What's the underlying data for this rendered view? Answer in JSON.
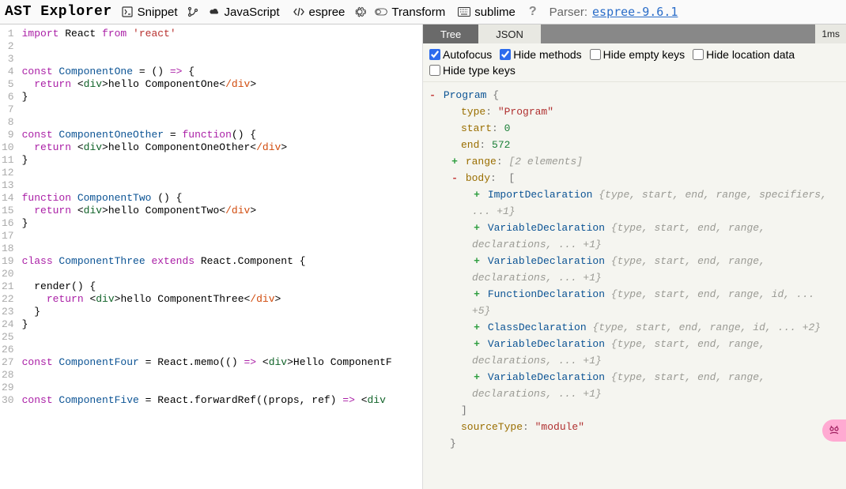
{
  "toolbar": {
    "brand": "AST Explorer",
    "snippet": "Snippet",
    "language": "JavaScript",
    "parser": "espree",
    "transform": "Transform",
    "keymap": "sublime",
    "parser_label": "Parser:",
    "parser_link": "espree-9.6.1"
  },
  "editor_lines": [
    {
      "n": 1,
      "tokens": [
        {
          "t": "import ",
          "c": "k"
        },
        {
          "t": "React ",
          "c": "plain"
        },
        {
          "t": "from ",
          "c": "k"
        },
        {
          "t": "'react'",
          "c": "str"
        }
      ]
    },
    {
      "n": 2,
      "tokens": []
    },
    {
      "n": 3,
      "tokens": []
    },
    {
      "n": 4,
      "tokens": [
        {
          "t": "const ",
          "c": "k"
        },
        {
          "t": "ComponentOne ",
          "c": "cls"
        },
        {
          "t": "= () ",
          "c": "plain"
        },
        {
          "t": "=>",
          "c": "k"
        },
        {
          "t": " {",
          "c": "plain"
        }
      ]
    },
    {
      "n": 5,
      "tokens": [
        {
          "t": "  ",
          "c": "plain"
        },
        {
          "t": "return ",
          "c": "k"
        },
        {
          "t": "<",
          "c": "plain"
        },
        {
          "t": "div",
          "c": "tag"
        },
        {
          "t": ">",
          "c": "plain"
        },
        {
          "t": "hello ComponentOne",
          "c": "plain"
        },
        {
          "t": "<",
          "c": "plain"
        },
        {
          "t": "/div",
          "c": "tagc"
        },
        {
          "t": ">",
          "c": "plain"
        }
      ]
    },
    {
      "n": 6,
      "tokens": [
        {
          "t": "}",
          "c": "plain"
        }
      ]
    },
    {
      "n": 7,
      "tokens": []
    },
    {
      "n": 8,
      "tokens": []
    },
    {
      "n": 9,
      "tokens": [
        {
          "t": "const ",
          "c": "k"
        },
        {
          "t": "ComponentOneOther ",
          "c": "cls"
        },
        {
          "t": "= ",
          "c": "plain"
        },
        {
          "t": "function",
          "c": "k"
        },
        {
          "t": "() {",
          "c": "plain"
        }
      ]
    },
    {
      "n": 10,
      "tokens": [
        {
          "t": "  ",
          "c": "plain"
        },
        {
          "t": "return ",
          "c": "k"
        },
        {
          "t": "<",
          "c": "plain"
        },
        {
          "t": "div",
          "c": "tag"
        },
        {
          "t": ">",
          "c": "plain"
        },
        {
          "t": "hello ComponentOneOther",
          "c": "plain"
        },
        {
          "t": "<",
          "c": "plain"
        },
        {
          "t": "/div",
          "c": "tagc"
        },
        {
          "t": ">",
          "c": "plain"
        }
      ]
    },
    {
      "n": 11,
      "tokens": [
        {
          "t": "}",
          "c": "plain"
        }
      ]
    },
    {
      "n": 12,
      "tokens": []
    },
    {
      "n": 13,
      "tokens": []
    },
    {
      "n": 14,
      "tokens": [
        {
          "t": "function ",
          "c": "k"
        },
        {
          "t": "ComponentTwo ",
          "c": "cls"
        },
        {
          "t": "() {",
          "c": "plain"
        }
      ]
    },
    {
      "n": 15,
      "tokens": [
        {
          "t": "  ",
          "c": "plain"
        },
        {
          "t": "return ",
          "c": "k"
        },
        {
          "t": "<",
          "c": "plain"
        },
        {
          "t": "div",
          "c": "tag"
        },
        {
          "t": ">",
          "c": "plain"
        },
        {
          "t": "hello ComponentTwo",
          "c": "plain"
        },
        {
          "t": "<",
          "c": "plain"
        },
        {
          "t": "/div",
          "c": "tagc"
        },
        {
          "t": ">",
          "c": "plain"
        }
      ]
    },
    {
      "n": 16,
      "tokens": [
        {
          "t": "}",
          "c": "plain"
        }
      ]
    },
    {
      "n": 17,
      "tokens": []
    },
    {
      "n": 18,
      "tokens": []
    },
    {
      "n": 19,
      "tokens": [
        {
          "t": "class ",
          "c": "k"
        },
        {
          "t": "ComponentThree ",
          "c": "cls"
        },
        {
          "t": "extends ",
          "c": "k"
        },
        {
          "t": "React.Component {",
          "c": "plain"
        }
      ]
    },
    {
      "n": 20,
      "tokens": []
    },
    {
      "n": 21,
      "tokens": [
        {
          "t": "  render() {",
          "c": "plain"
        }
      ]
    },
    {
      "n": 22,
      "tokens": [
        {
          "t": "    ",
          "c": "plain"
        },
        {
          "t": "return ",
          "c": "k"
        },
        {
          "t": "<",
          "c": "plain"
        },
        {
          "t": "div",
          "c": "tag"
        },
        {
          "t": ">",
          "c": "plain"
        },
        {
          "t": "hello ComponentThree",
          "c": "plain"
        },
        {
          "t": "<",
          "c": "plain"
        },
        {
          "t": "/div",
          "c": "tagc"
        },
        {
          "t": ">",
          "c": "plain"
        }
      ]
    },
    {
      "n": 23,
      "tokens": [
        {
          "t": "  }",
          "c": "plain"
        }
      ]
    },
    {
      "n": 24,
      "tokens": [
        {
          "t": "}",
          "c": "plain"
        }
      ]
    },
    {
      "n": 25,
      "tokens": []
    },
    {
      "n": 26,
      "tokens": []
    },
    {
      "n": 27,
      "tokens": [
        {
          "t": "const ",
          "c": "k"
        },
        {
          "t": "ComponentFour ",
          "c": "cls"
        },
        {
          "t": "= React.memo(() ",
          "c": "plain"
        },
        {
          "t": "=>",
          "c": "k"
        },
        {
          "t": " <",
          "c": "plain"
        },
        {
          "t": "div",
          "c": "tag"
        },
        {
          "t": ">",
          "c": "plain"
        },
        {
          "t": "Hello ComponentF",
          "c": "plain"
        }
      ]
    },
    {
      "n": 28,
      "tokens": []
    },
    {
      "n": 29,
      "tokens": []
    },
    {
      "n": 30,
      "tokens": [
        {
          "t": "const ",
          "c": "k"
        },
        {
          "t": "ComponentFive ",
          "c": "cls"
        },
        {
          "t": "= React.forwardRef((props, ref) ",
          "c": "plain"
        },
        {
          "t": "=>",
          "c": "k"
        },
        {
          "t": " <",
          "c": "plain"
        },
        {
          "t": "div",
          "c": "tag"
        }
      ]
    }
  ],
  "right": {
    "tabs": {
      "tree": "Tree",
      "json": "JSON"
    },
    "time": "1ms",
    "options": {
      "autofocus": {
        "label": "Autofocus",
        "checked": true
      },
      "hide_methods": {
        "label": "Hide methods",
        "checked": true
      },
      "hide_empty_keys": {
        "label": "Hide empty keys",
        "checked": false
      },
      "hide_location_data": {
        "label": "Hide location data",
        "checked": false
      },
      "hide_type_keys": {
        "label": "Hide type keys",
        "checked": false
      }
    }
  },
  "ast": {
    "root_label": "Program",
    "type_key": "type",
    "type_val": "\"Program\"",
    "start_key": "start",
    "start_val": "0",
    "end_key": "end",
    "end_val": "572",
    "range_key": "range",
    "range_preview": "[2 elements]",
    "body_key": "body",
    "body_open": "[",
    "body_close": "]",
    "sourceType_key": "sourceType",
    "sourceType_val": "\"module\"",
    "items": [
      {
        "name": "ImportDeclaration",
        "preview": "{type, start, end, range, specifiers, ... +1}"
      },
      {
        "name": "VariableDeclaration",
        "preview": "{type, start, end, range, declarations, ... +1}"
      },
      {
        "name": "VariableDeclaration",
        "preview": "{type, start, end, range, declarations, ... +1}"
      },
      {
        "name": "FunctionDeclaration",
        "preview": "{type, start, end, range, id, ... +5}"
      },
      {
        "name": "ClassDeclaration",
        "preview": "{type, start, end, range, id, ... +2}"
      },
      {
        "name": "VariableDeclaration",
        "preview": "{type, start, end, range, declarations, ... +1}"
      },
      {
        "name": "VariableDeclaration",
        "preview": "{type, start, end, range, declarations, ... +1}"
      }
    ]
  }
}
